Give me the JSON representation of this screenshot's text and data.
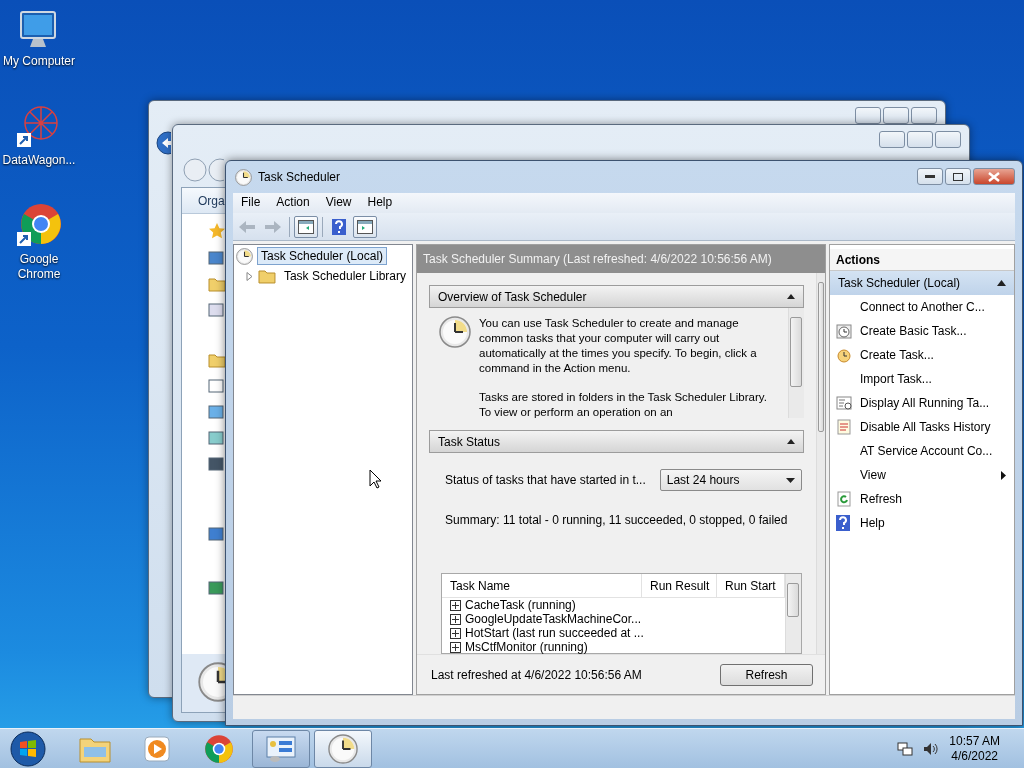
{
  "desktop_icons": [
    {
      "label": "My Computer",
      "kind": "computer"
    },
    {
      "label": "DataWagon...",
      "kind": "web-shortcut"
    },
    {
      "label": "Google Chrome",
      "kind": "chrome"
    }
  ],
  "behind_windows": [
    {
      "kind": "back-arrow"
    },
    {
      "kind": "explorer",
      "toolbar": "Orga"
    }
  ],
  "window": {
    "title": "Task Scheduler",
    "menu": [
      "File",
      "Action",
      "View",
      "Help"
    ],
    "toolbar": [
      {
        "kind": "back",
        "disabled": true,
        "on": false
      },
      {
        "kind": "forward",
        "disabled": true,
        "on": false
      },
      {
        "kind": "console-tree",
        "disabled": false,
        "on": true
      },
      {
        "kind": "help",
        "disabled": false,
        "on": false
      },
      {
        "kind": "action-pane",
        "disabled": false,
        "on": true
      }
    ]
  },
  "tree": [
    {
      "label": "Task Scheduler (Local)",
      "selected": true,
      "children": [
        {
          "label": "Task Scheduler Library",
          "selected": false,
          "expanded": false
        }
      ]
    }
  ],
  "summary": {
    "header": "Task Scheduler Summary (Last refreshed: 4/6/2022 10:56:56 AM)",
    "overview": {
      "title": "Overview of Task Scheduler",
      "expanded": true,
      "paragraphs": [
        "You can use Task Scheduler to create and manage common tasks that your computer will carry out automatically at the times you specify. To begin, click a command in the Action menu.",
        "Tasks are stored in folders in the Task Scheduler Library. To view or perform an operation on an"
      ]
    },
    "task_status": {
      "title": "Task Status",
      "expanded": true,
      "filter_label": "Status of tasks that have started in t...",
      "filter_value": "Last 24 hours",
      "summary": "Summary: 11 total - 0 running, 11 succeeded, 0 stopped, 0 failed",
      "columns": [
        "Task Name",
        "Run Result",
        "Run Start"
      ],
      "rows": [
        {
          "name": "CacheTask (running)",
          "expanded": false
        },
        {
          "name": "GoogleUpdateTaskMachineCor...",
          "expanded": false
        },
        {
          "name": "HotStart (last run succeeded at ...",
          "expanded": false
        },
        {
          "name": "MsCtfMonitor (running)",
          "expanded": false
        }
      ]
    },
    "footer": "Last refreshed at 4/6/2022 10:56:56 AM",
    "refresh_button": "Refresh"
  },
  "actions": {
    "title": "Actions",
    "group": "Task Scheduler (Local)",
    "expanded": true,
    "items": [
      {
        "label": "Connect to Another C...",
        "kind": "plain"
      },
      {
        "label": "Create Basic Task...",
        "kind": "basic-task"
      },
      {
        "label": "Create Task...",
        "kind": "task"
      },
      {
        "label": "Import Task...",
        "kind": "plain"
      },
      {
        "label": "Display All Running Ta...",
        "kind": "running"
      },
      {
        "label": "Disable All Tasks History",
        "kind": "history"
      },
      {
        "label": "AT Service Account Co...",
        "kind": "plain"
      },
      {
        "label": "View",
        "kind": "submenu"
      },
      {
        "label": "Refresh",
        "kind": "refresh"
      },
      {
        "label": "Help",
        "kind": "help"
      }
    ]
  },
  "taskbar": {
    "items": [
      {
        "kind": "explorer",
        "open": false,
        "selected": false
      },
      {
        "kind": "media-player",
        "open": false,
        "selected": false
      },
      {
        "kind": "chrome",
        "open": false,
        "selected": false
      },
      {
        "kind": "control-panel",
        "open": true,
        "selected": false
      },
      {
        "kind": "task-scheduler",
        "open": true,
        "selected": true
      }
    ],
    "time": "10:57 AM",
    "date": "4/6/2022"
  }
}
